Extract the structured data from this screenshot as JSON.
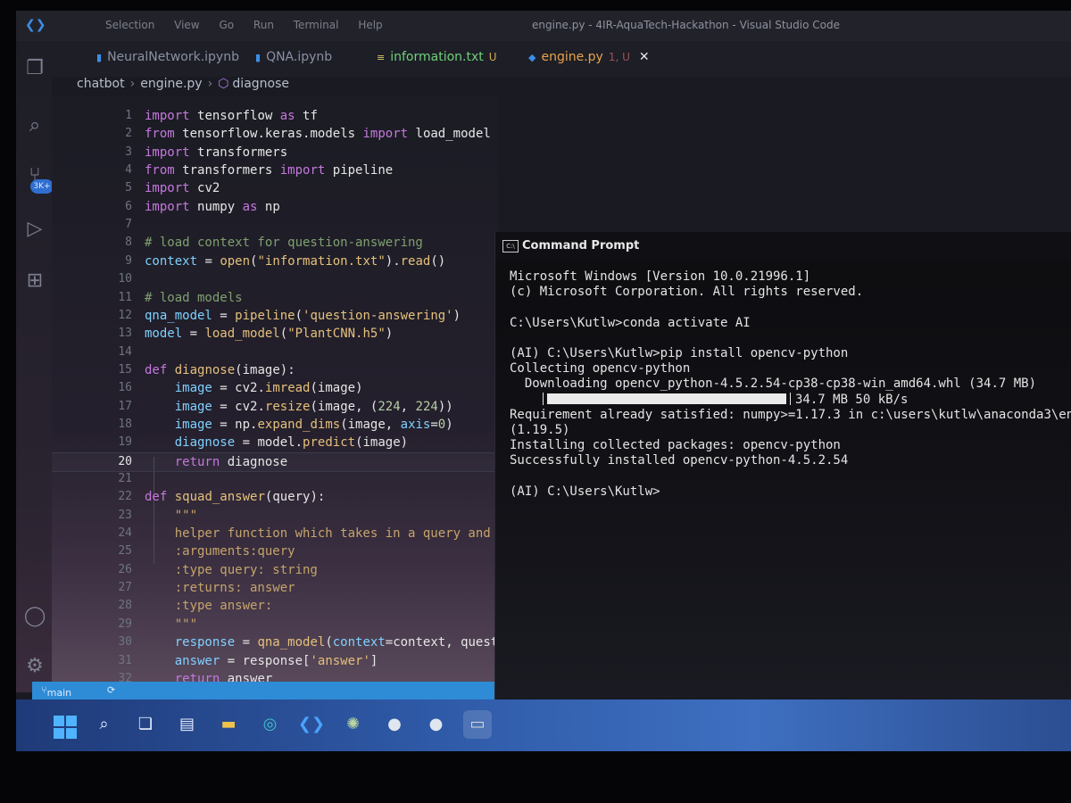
{
  "window": {
    "title": "engine.py - 4IR-AquaTech-Hackathon - Visual Studio Code",
    "menu": [
      "Selection",
      "View",
      "Go",
      "Run",
      "Terminal",
      "Help"
    ]
  },
  "tabs": [
    {
      "label": "NeuralNetwork.ipynb",
      "icon": "notebook-icon"
    },
    {
      "label": "QNA.ipynb",
      "icon": "notebook-icon"
    },
    {
      "label": "information.txt",
      "badge": "U",
      "icon": "text-file-icon"
    },
    {
      "label": "engine.py",
      "badge": "1, U",
      "icon": "python-icon",
      "active": true
    }
  ],
  "breadcrumb": {
    "folder": "chatbot",
    "file": "engine.py",
    "symbol": "diagnose"
  },
  "activity_bar": {
    "icons": [
      "explorer-icon",
      "search-icon",
      "source-control-icon",
      "run-debug-icon",
      "extensions-icon",
      "account-icon",
      "settings-gear-icon"
    ],
    "badge": "3K+"
  },
  "editor": {
    "current_line": 20,
    "lines": [
      {
        "n": "1",
        "t": "import tensorflow as tf"
      },
      {
        "n": "2",
        "t": "from tensorflow.keras.models import load_model"
      },
      {
        "n": "3",
        "t": "import transformers"
      },
      {
        "n": "4",
        "t": "from transformers import pipeline"
      },
      {
        "n": "5",
        "t": "import cv2"
      },
      {
        "n": "6",
        "t": "import numpy as np"
      },
      {
        "n": "7",
        "t": ""
      },
      {
        "n": "8",
        "t": "# load context for question-answering"
      },
      {
        "n": "9",
        "t": "context = open(\"information.txt\").read()"
      },
      {
        "n": "10",
        "t": ""
      },
      {
        "n": "11",
        "t": "# load models"
      },
      {
        "n": "12",
        "t": "qna_model = pipeline('question-answering')"
      },
      {
        "n": "13",
        "t": "model = load_model(\"PlantCNN.h5\")"
      },
      {
        "n": "14",
        "t": ""
      },
      {
        "n": "15",
        "t": "def diagnose(image):"
      },
      {
        "n": "16",
        "t": "    image = cv2.imread(image)"
      },
      {
        "n": "17",
        "t": "    image = cv2.resize(image, (224, 224))"
      },
      {
        "n": "18",
        "t": "    image = np.expand_dims(image, axis=0)"
      },
      {
        "n": "19",
        "t": "    diagnose = model.predict(image)"
      },
      {
        "n": "20",
        "t": "    return diagnose"
      },
      {
        "n": "21",
        "t": ""
      },
      {
        "n": "22",
        "t": "def squad_answer(query):"
      },
      {
        "n": "23",
        "t": "    \"\"\""
      },
      {
        "n": "24",
        "t": "    helper function which takes in a query and pa"
      },
      {
        "n": "25",
        "t": "    :arguments:query"
      },
      {
        "n": "26",
        "t": "    :type query: string"
      },
      {
        "n": "27",
        "t": "    :returns: answer"
      },
      {
        "n": "28",
        "t": "    :type answer:"
      },
      {
        "n": "29",
        "t": "    \"\"\""
      },
      {
        "n": "30",
        "t": "    response = qna_model(context=context, questio"
      },
      {
        "n": "31",
        "t": "    answer = response['answer']"
      },
      {
        "n": "32",
        "t": "    return answer"
      }
    ]
  },
  "statusbar": {
    "branch": "main",
    "sync": "⟳"
  },
  "command_prompt": {
    "title": "Command Prompt",
    "lines": [
      "Microsoft Windows [Version 10.0.21996.1]",
      "(c) Microsoft Corporation. All rights reserved.",
      "",
      "C:\\Users\\Kutlw>conda activate AI",
      "",
      "(AI) C:\\Users\\Kutlw>pip install opencv-python",
      "Collecting opencv-python",
      "  Downloading opencv_python-4.5.2.54-cp38-cp38-win_amd64.whl (34.7 MB)",
      "",
      "Requirement already satisfied: numpy>=1.17.3 in c:\\users\\kutlw\\anaconda3\\en",
      "(1.19.5)",
      "Installing collected packages: opencv-python",
      "Successfully installed opencv-python-4.5.2.54",
      "",
      "(AI) C:\\Users\\Kutlw>"
    ],
    "progress": {
      "fraction": 1.0,
      "text": "34.7 MB 50 kB/s"
    }
  },
  "taskbar": {
    "icons": [
      "windows-start-icon",
      "search-icon",
      "task-view-icon",
      "widgets-icon",
      "file-explorer-icon",
      "edge-browser-icon",
      "vscode-icon",
      "android-icon",
      "app-circle-icon",
      "app-circle-icon",
      "command-prompt-icon"
    ]
  },
  "colors": {
    "accent": "#2e8bd6",
    "taskbar": "#2f5aa8",
    "keyword": "#c678dd",
    "function": "#e5c07b"
  }
}
